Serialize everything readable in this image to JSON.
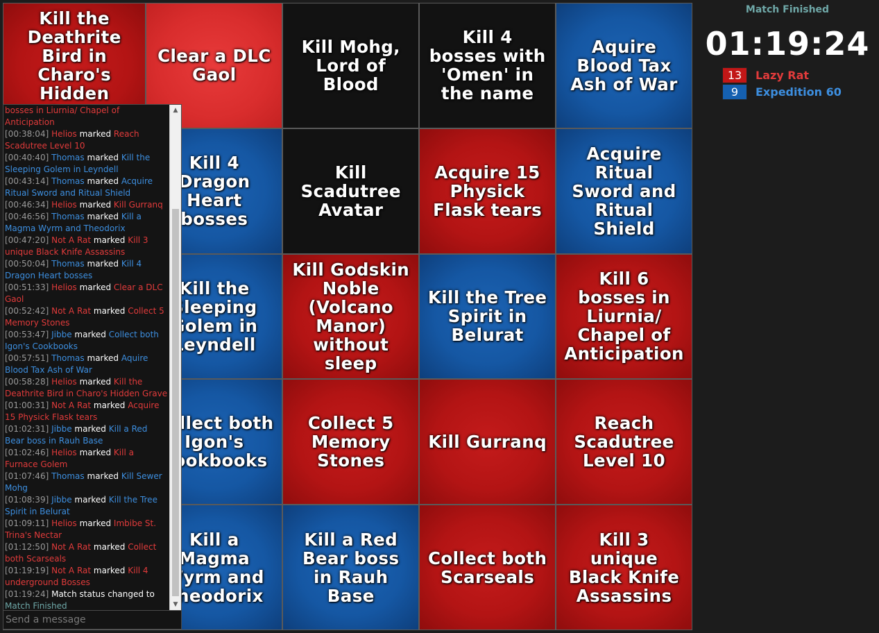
{
  "board": {
    "cells": [
      {
        "text": "Kill the Deathrite Bird in Charo's Hidden Grave",
        "color": "red"
      },
      {
        "text": "Clear a DLC Gaol",
        "color": "hl"
      },
      {
        "text": "Kill Mohg, Lord of Blood",
        "color": "black"
      },
      {
        "text": "Kill 4 bosses with 'Omen' in the name",
        "color": "black"
      },
      {
        "text": "Aquire Blood Tax Ash of War",
        "color": "blue"
      },
      {
        "text": "Kill a Furnace Golem",
        "color": "red"
      },
      {
        "text": "Kill 4 Dragon Heart bosses",
        "color": "blue"
      },
      {
        "text": "Kill Scadutree Avatar",
        "color": "black"
      },
      {
        "text": "Acquire 15 Physick Flask tears",
        "color": "red"
      },
      {
        "text": "Acquire Ritual Sword and Ritual Shield",
        "color": "blue"
      },
      {
        "text": "Kill Sewer Mohg",
        "color": "blue"
      },
      {
        "text": "Kill the Sleeping Golem in Leyndell",
        "color": "blue"
      },
      {
        "text": "Kill Godskin Noble (Volcano Manor) without sleep",
        "color": "red"
      },
      {
        "text": "Kill the Tree Spirit in Belurat",
        "color": "blue"
      },
      {
        "text": "Kill 6 bosses in Liurnia/ Chapel of Anticipation",
        "color": "red"
      },
      {
        "text": "Kill 4 underground Bosses",
        "color": "red"
      },
      {
        "text": "Collect both Igon's Cookbooks",
        "color": "blue"
      },
      {
        "text": "Collect 5 Memory Stones",
        "color": "red"
      },
      {
        "text": "Kill Gurranq",
        "color": "red"
      },
      {
        "text": "Reach Scadutree Level 10",
        "color": "red"
      },
      {
        "text": "Imbibe St. Trina's Nectar",
        "color": "red"
      },
      {
        "text": "Kill a Magma Wyrm and Theodorix",
        "color": "blue"
      },
      {
        "text": "Kill a Red Bear boss in Rauh Base",
        "color": "blue"
      },
      {
        "text": "Collect both Scarseals",
        "color": "red"
      },
      {
        "text": "Kill 3 unique Black Knife Assassins",
        "color": "red"
      }
    ]
  },
  "match": {
    "status": "Match Finished",
    "timer": "01:19:24"
  },
  "teams": {
    "red": {
      "score": "13",
      "name": "Lazy Rat",
      "color": "#e23b3b"
    },
    "blue": {
      "score": "9",
      "name": "Expedition 60",
      "color": "#3d8fe0"
    }
  },
  "chat": {
    "messages": [
      {
        "ts": "",
        "player": "",
        "team": "",
        "action": "",
        "goal": "bosses in Liurnia/ Chapel of Anticipation",
        "goal_team": "red"
      },
      {
        "ts": "[00:38:04]",
        "player": "Helios",
        "team": "red",
        "action": "marked",
        "goal": "Reach Scadutree Level 10",
        "goal_team": "red"
      },
      {
        "ts": "[00:40:40]",
        "player": "Thomas",
        "team": "blue",
        "action": "marked",
        "goal": "Kill the Sleeping Golem in Leyndell",
        "goal_team": "blue"
      },
      {
        "ts": "[00:43:14]",
        "player": "Thomas",
        "team": "blue",
        "action": "marked",
        "goal": "Acquire Ritual Sword and Ritual Shield",
        "goal_team": "blue"
      },
      {
        "ts": "[00:46:34]",
        "player": "Helios",
        "team": "red",
        "action": "marked",
        "goal": "Kill Gurranq",
        "goal_team": "red"
      },
      {
        "ts": "[00:46:56]",
        "player": "Thomas",
        "team": "blue",
        "action": "marked",
        "goal": "Kill a Magma Wyrm and Theodorix",
        "goal_team": "blue"
      },
      {
        "ts": "[00:47:20]",
        "player": "Not A Rat",
        "team": "red",
        "action": "marked",
        "goal": "Kill 3 unique Black Knife Assassins",
        "goal_team": "red"
      },
      {
        "ts": "[00:50:04]",
        "player": "Thomas",
        "team": "blue",
        "action": "marked",
        "goal": "Kill 4 Dragon Heart bosses",
        "goal_team": "blue"
      },
      {
        "ts": "[00:51:33]",
        "player": "Helios",
        "team": "red",
        "action": "marked",
        "goal": "Clear a DLC Gaol",
        "goal_team": "red"
      },
      {
        "ts": "[00:52:42]",
        "player": "Not A Rat",
        "team": "red",
        "action": "marked",
        "goal": "Collect 5 Memory Stones",
        "goal_team": "red"
      },
      {
        "ts": "[00:53:47]",
        "player": "Jibbe",
        "team": "blue",
        "action": "marked",
        "goal": "Collect both Igon's Cookbooks",
        "goal_team": "blue"
      },
      {
        "ts": "[00:57:51]",
        "player": "Thomas",
        "team": "blue",
        "action": "marked",
        "goal": "Aquire Blood Tax Ash of War",
        "goal_team": "blue"
      },
      {
        "ts": "[00:58:28]",
        "player": "Helios",
        "team": "red",
        "action": "marked",
        "goal": "Kill the Deathrite Bird in Charo's Hidden Grave",
        "goal_team": "red"
      },
      {
        "ts": "[01:00:31]",
        "player": "Not A Rat",
        "team": "red",
        "action": "marked",
        "goal": "Acquire 15 Physick Flask tears",
        "goal_team": "red"
      },
      {
        "ts": "[01:02:31]",
        "player": "Jibbe",
        "team": "blue",
        "action": "marked",
        "goal": "Kill a Red Bear boss in Rauh Base",
        "goal_team": "blue"
      },
      {
        "ts": "[01:02:46]",
        "player": "Helios",
        "team": "red",
        "action": "marked",
        "goal": "Kill a Furnace Golem",
        "goal_team": "red"
      },
      {
        "ts": "[01:07:46]",
        "player": "Thomas",
        "team": "blue",
        "action": "marked",
        "goal": "Kill Sewer Mohg",
        "goal_team": "blue"
      },
      {
        "ts": "[01:08:39]",
        "player": "Jibbe",
        "team": "blue",
        "action": "marked",
        "goal": "Kill the Tree Spirit in Belurat",
        "goal_team": "blue"
      },
      {
        "ts": "[01:09:11]",
        "player": "Helios",
        "team": "red",
        "action": "marked",
        "goal": "Imbibe St. Trina's Nectar",
        "goal_team": "red"
      },
      {
        "ts": "[01:12:50]",
        "player": "Not A Rat",
        "team": "red",
        "action": "marked",
        "goal": "Collect both Scarseals",
        "goal_team": "red"
      },
      {
        "ts": "[01:19:19]",
        "player": "Not A Rat",
        "team": "red",
        "action": "marked",
        "goal": "Kill 4 underground Bosses",
        "goal_team": "red"
      },
      {
        "ts": "[01:19:24]",
        "player": "",
        "team": "",
        "action": "Match status changed to",
        "goal": "Match Finished",
        "goal_team": "status"
      }
    ],
    "input_placeholder": "Send a message",
    "scroll_up_icon": "▲",
    "scroll_down_icon": "▼"
  }
}
